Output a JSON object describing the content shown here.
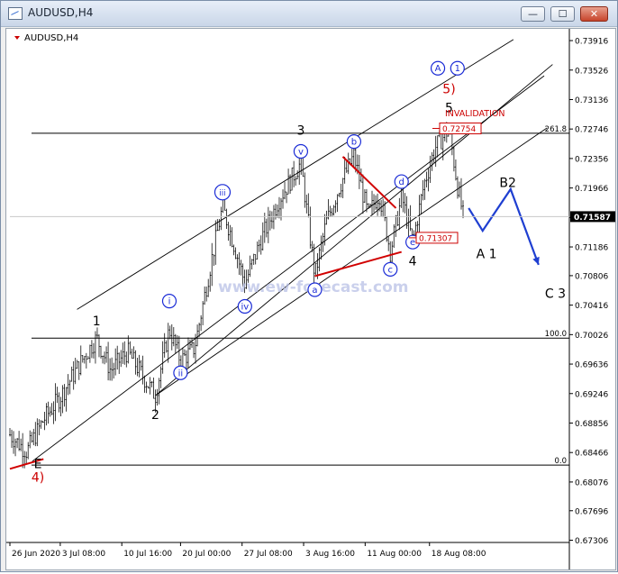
{
  "window": {
    "title": "AUDUSD,H4",
    "minimize_glyph": "—",
    "maximize_glyph": "☐",
    "close_glyph": "✕"
  },
  "chart_data": {
    "type": "candlestick",
    "symbol_label": "AUDUSD,H4",
    "watermark": "www.ew-forecast.com",
    "ylim": [
      0.673,
      0.74
    ],
    "y_ticks": [
      "0.73916",
      "0.73526",
      "0.73136",
      "0.72746",
      "0.72356",
      "0.71966",
      "0.71576",
      "0.71186",
      "0.70806",
      "0.70416",
      "0.70026",
      "0.69636",
      "0.69246",
      "0.68856",
      "0.68466",
      "0.68076",
      "0.67696",
      "0.67306"
    ],
    "y_tick_values": [
      0.73916,
      0.73526,
      0.73136,
      0.72746,
      0.72356,
      0.71966,
      0.71576,
      0.71186,
      0.70806,
      0.70416,
      0.70026,
      0.69636,
      0.69246,
      0.68856,
      0.68466,
      0.68076,
      0.67696,
      0.67306
    ],
    "x_labels": [
      "26 Jun 2020",
      "3 Jul 08:00",
      "10 Jul 16:00",
      "20 Jul 00:00",
      "27 Jul 08:00",
      "3 Aug 16:00",
      "11 Aug 00:00",
      "18 Aug 08:00"
    ],
    "x_label_positions": [
      0.0,
      0.09,
      0.2,
      0.305,
      0.415,
      0.525,
      0.635,
      0.75
    ],
    "current_price": "0.71587",
    "current_price_value": 0.71587,
    "fib_levels": [
      {
        "label": "261.8",
        "value": 0.7269
      },
      {
        "label": "100.0",
        "value": 0.6998
      },
      {
        "label": "0.0",
        "value": 0.683
      }
    ],
    "price_tags": [
      {
        "label": "0.72754",
        "value": 0.72754,
        "color": "#cc0000"
      },
      {
        "label": "0.71307",
        "value": 0.71307,
        "color": "#cc0000"
      }
    ],
    "invalidation_label": "INVALIDATION",
    "waves": [
      {
        "label": "E",
        "t": 0.05,
        "v": 0.6826,
        "color": "#000000",
        "style": "plain"
      },
      {
        "label": "4)",
        "t": 0.05,
        "v": 0.6808,
        "color": "#cc0000",
        "style": "plain"
      },
      {
        "label": "1",
        "t": 0.155,
        "v": 0.7015,
        "color": "#000000",
        "style": "plain"
      },
      {
        "label": "2",
        "t": 0.26,
        "v": 0.6891,
        "color": "#000000",
        "style": "plain"
      },
      {
        "label": "i",
        "t": 0.285,
        "v": 0.7047,
        "color": "#1a2bd6",
        "style": "circle"
      },
      {
        "label": "ii",
        "t": 0.305,
        "v": 0.6952,
        "color": "#1a2bd6",
        "style": "circle"
      },
      {
        "label": "iii",
        "t": 0.38,
        "v": 0.7191,
        "color": "#1a2bd6",
        "style": "circle"
      },
      {
        "label": "iv",
        "t": 0.42,
        "v": 0.704,
        "color": "#1a2bd6",
        "style": "circle"
      },
      {
        "label": "3",
        "t": 0.52,
        "v": 0.7267,
        "color": "#000000",
        "style": "plain"
      },
      {
        "label": "v",
        "t": 0.52,
        "v": 0.7245,
        "color": "#1a2bd6",
        "style": "circle"
      },
      {
        "label": "a",
        "t": 0.545,
        "v": 0.7062,
        "color": "#1a2bd6",
        "style": "circle"
      },
      {
        "label": "b",
        "t": 0.615,
        "v": 0.7258,
        "color": "#1a2bd6",
        "style": "circle"
      },
      {
        "label": "c",
        "t": 0.68,
        "v": 0.7089,
        "color": "#1a2bd6",
        "style": "circle"
      },
      {
        "label": "d",
        "t": 0.7,
        "v": 0.7205,
        "color": "#1a2bd6",
        "style": "circle"
      },
      {
        "label": "4",
        "t": 0.72,
        "v": 0.7094,
        "color": "#000000",
        "style": "plain"
      },
      {
        "label": "e",
        "t": 0.72,
        "v": 0.7125,
        "color": "#1a2bd6",
        "style": "circle"
      },
      {
        "label": "5",
        "t": 0.785,
        "v": 0.7297,
        "color": "#000000",
        "style": "plain"
      },
      {
        "label": "5)",
        "t": 0.785,
        "v": 0.7322,
        "color": "#cc0000",
        "style": "plain"
      },
      {
        "label": "A",
        "t": 0.765,
        "v": 0.7355,
        "color": "#1a2bd6",
        "style": "circle"
      },
      {
        "label": "1",
        "t": 0.8,
        "v": 0.7355,
        "color": "#1a2bd6",
        "style": "circle"
      },
      {
        "label": "A 1",
        "t": 0.852,
        "v": 0.7104,
        "color": "#000000",
        "style": "plain"
      },
      {
        "label": "B2",
        "t": 0.89,
        "v": 0.7198,
        "color": "#000000",
        "style": "plain"
      },
      {
        "label": "C 3",
        "t": 0.975,
        "v": 0.7051,
        "color": "#000000",
        "style": "plain"
      }
    ],
    "projection": [
      {
        "t": 0.82,
        "v": 0.717
      },
      {
        "t": 0.845,
        "v": 0.714
      },
      {
        "t": 0.895,
        "v": 0.7195
      },
      {
        "t": 0.945,
        "v": 0.7095
      }
    ],
    "price_path": [
      {
        "t": 0.0,
        "v": 0.687
      },
      {
        "t": 0.03,
        "v": 0.6848
      },
      {
        "t": 0.06,
        "v": 0.689
      },
      {
        "t": 0.09,
        "v": 0.692
      },
      {
        "t": 0.13,
        "v": 0.697
      },
      {
        "t": 0.155,
        "v": 0.6998
      },
      {
        "t": 0.18,
        "v": 0.6955
      },
      {
        "t": 0.21,
        "v": 0.698
      },
      {
        "t": 0.24,
        "v": 0.6945
      },
      {
        "t": 0.26,
        "v": 0.6922
      },
      {
        "t": 0.285,
        "v": 0.701
      },
      {
        "t": 0.305,
        "v": 0.6968
      },
      {
        "t": 0.33,
        "v": 0.6985
      },
      {
        "t": 0.36,
        "v": 0.71
      },
      {
        "t": 0.38,
        "v": 0.7172
      },
      {
        "t": 0.405,
        "v": 0.711
      },
      {
        "t": 0.42,
        "v": 0.707
      },
      {
        "t": 0.45,
        "v": 0.713
      },
      {
        "t": 0.48,
        "v": 0.718
      },
      {
        "t": 0.52,
        "v": 0.723
      },
      {
        "t": 0.535,
        "v": 0.714
      },
      {
        "t": 0.545,
        "v": 0.708
      },
      {
        "t": 0.565,
        "v": 0.715
      },
      {
        "t": 0.59,
        "v": 0.72
      },
      {
        "t": 0.615,
        "v": 0.724
      },
      {
        "t": 0.64,
        "v": 0.716
      },
      {
        "t": 0.66,
        "v": 0.719
      },
      {
        "t": 0.68,
        "v": 0.7112
      },
      {
        "t": 0.7,
        "v": 0.7185
      },
      {
        "t": 0.72,
        "v": 0.7125
      },
      {
        "t": 0.74,
        "v": 0.72
      },
      {
        "t": 0.76,
        "v": 0.725
      },
      {
        "t": 0.785,
        "v": 0.7275
      },
      {
        "t": 0.8,
        "v": 0.72
      },
      {
        "t": 0.81,
        "v": 0.716
      }
    ],
    "channel_lines": [
      {
        "t1": 0.12,
        "v1": 0.7036,
        "t2": 0.9,
        "v2": 0.7393
      },
      {
        "t1": 0.26,
        "v1": 0.6922,
        "t2": 0.96,
        "v2": 0.7276
      },
      {
        "t1": 0.04,
        "v1": 0.6835,
        "t2": 0.955,
        "v2": 0.7345
      },
      {
        "t1": 0.26,
        "v1": 0.6922,
        "t2": 0.97,
        "v2": 0.736
      }
    ],
    "red_lines": [
      {
        "t1": 0.0,
        "v1": 0.6825,
        "t2": 0.06,
        "v2": 0.6838
      },
      {
        "t1": 0.545,
        "v1": 0.708,
        "t2": 0.7,
        "v2": 0.7112
      },
      {
        "t1": 0.595,
        "v1": 0.7238,
        "t2": 0.69,
        "v2": 0.717
      }
    ]
  }
}
